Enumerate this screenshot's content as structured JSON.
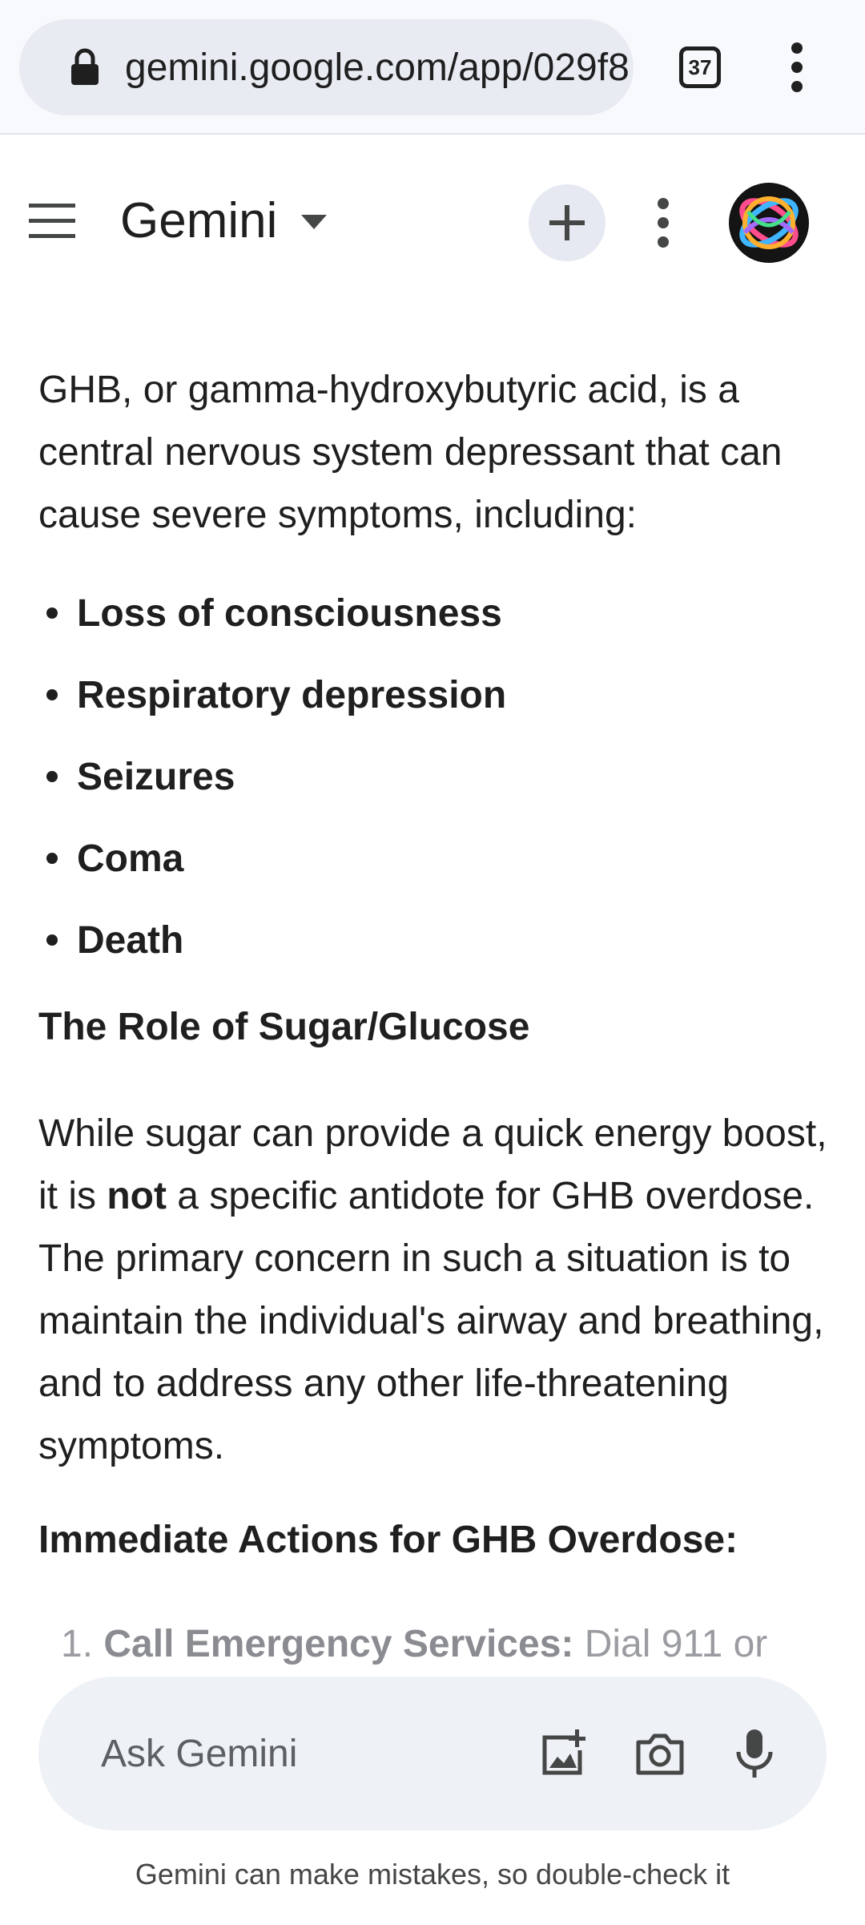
{
  "browser": {
    "url": "gemini.google.com/app/029f8",
    "tab_count": "37"
  },
  "header": {
    "title": "Gemini"
  },
  "content": {
    "intro": "GHB, or gamma-hydroxybutyric acid, is a central nervous system depressant that can cause severe symptoms, including:",
    "symptoms": [
      "Loss of consciousness",
      "Respiratory depression",
      "Seizures",
      "Coma",
      "Death"
    ],
    "sugar_heading": "The Role of Sugar/Glucose",
    "sugar_para_before": "While sugar can provide a quick energy boost, it is ",
    "sugar_para_bold": "not",
    "sugar_para_after": " a specific antidote for GHB overdose. The primary concern in such a situation is to maintain the individual's airway and breathing, and to address any other life-threatening symptoms.",
    "actions_heading": "Immediate Actions for GHB Overdose:",
    "step1_number": "1.",
    "step1_bold": "Call Emergency Services:",
    "step1_text": " Dial 911 or"
  },
  "input": {
    "placeholder": "Ask Gemini"
  },
  "footer": {
    "disclaimer": "Gemini can make mistakes, so double-check it"
  }
}
